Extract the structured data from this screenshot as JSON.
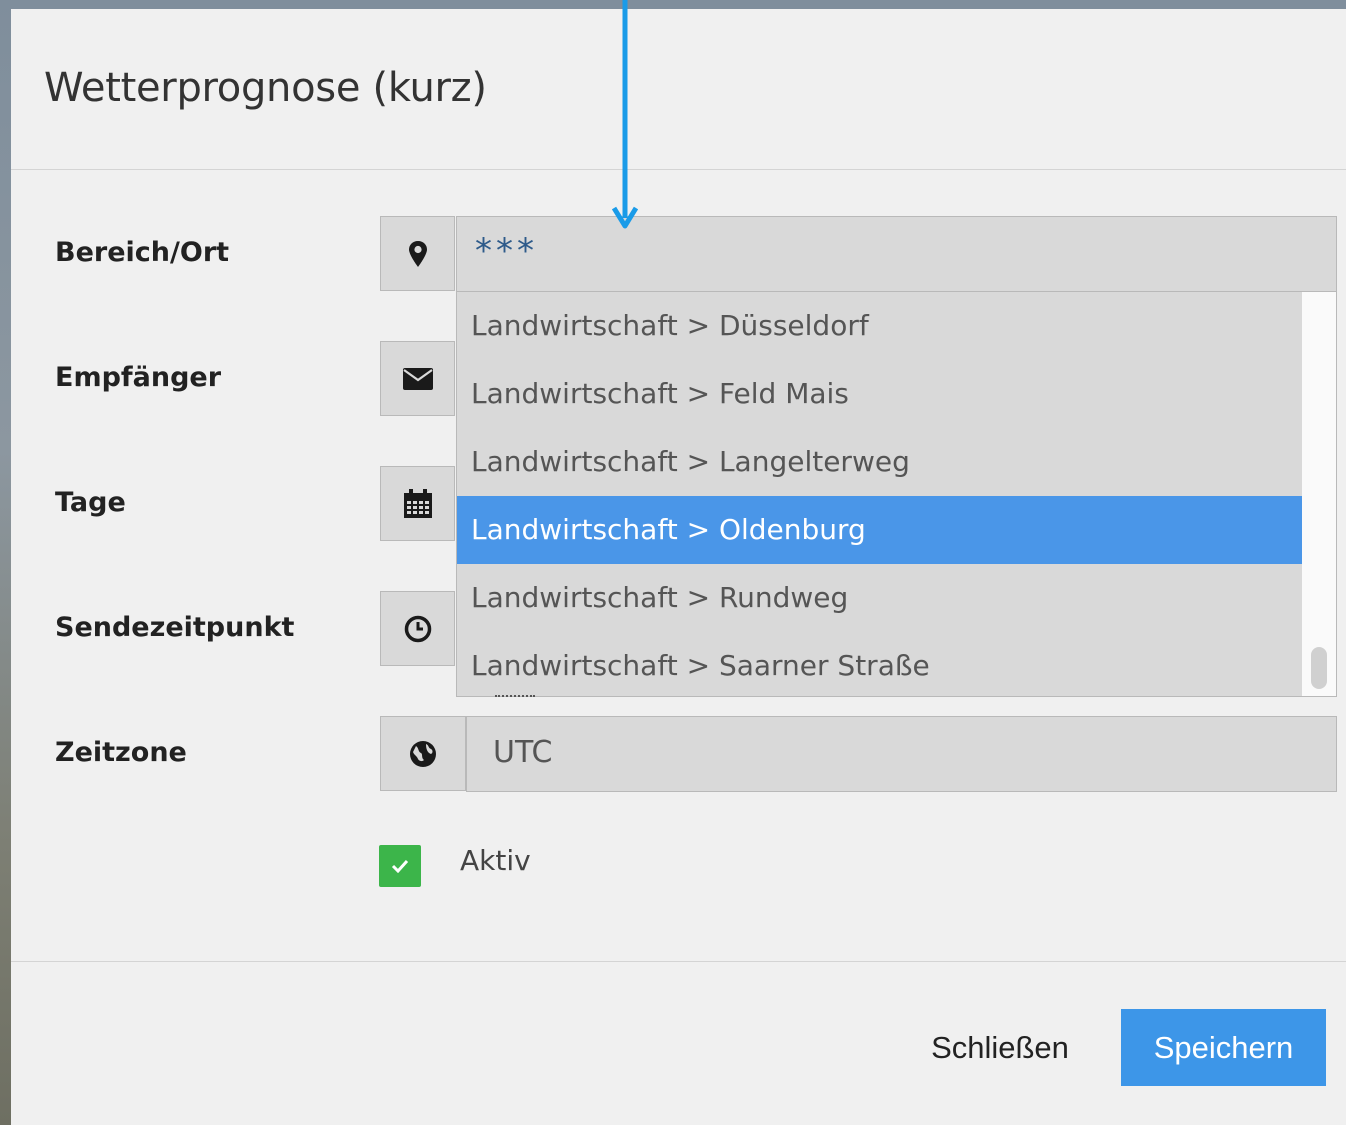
{
  "modal": {
    "title": "Wetterprognose (kurz)"
  },
  "form": {
    "rows": [
      {
        "label": "Bereich/Ort",
        "icon": "map-marker-icon"
      },
      {
        "label": "Empfänger",
        "icon": "envelope-icon"
      },
      {
        "label": "Tage",
        "icon": "calendar-icon"
      },
      {
        "label": "Sendezeitpunkt",
        "icon": "clock-icon"
      },
      {
        "label": "Zeitzone",
        "icon": "globe-icon"
      }
    ],
    "location_search": {
      "value": "***"
    },
    "location_dropdown": {
      "items": [
        "Landwirtschaft > Düsseldorf",
        "Landwirtschaft > Feld Mais",
        "Landwirtschaft > Langelterweg",
        "Landwirtschaft > Oldenburg",
        "Landwirtschaft > Rundweg",
        "Landwirtschaft > Saarner Straße"
      ],
      "selected_index": 3
    },
    "timezone": {
      "value": "UTC"
    },
    "active": {
      "label": "Aktiv",
      "checked": true
    }
  },
  "footer": {
    "close_label": "Schließen",
    "save_label": "Speichern"
  },
  "colors": {
    "accent": "#3d96e8",
    "selected_item": "#4a96e8",
    "checkbox": "#3cb54a",
    "annotation_arrow": "#1a9be8"
  }
}
